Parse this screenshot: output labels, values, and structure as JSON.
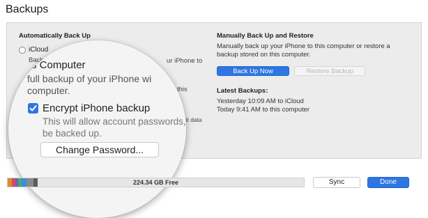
{
  "title": "Backups",
  "auto_backup": {
    "heading": "Automatically Back Up",
    "icloud_label": "iCloud",
    "icloud_desc_fragment": "Back",
    "icloud_desc_right": "ur iPhone to",
    "computer_desc_right": "this",
    "homekit_fragment": "meKit data to"
  },
  "magnifier": {
    "computer_label": "s Computer",
    "computer_desc_line1": "full backup of your iPhone wi",
    "computer_desc_line2": "computer.",
    "encrypt_label": "Encrypt iPhone backup",
    "encrypt_checked": true,
    "encrypt_desc_line1": "This will allow account passwords,",
    "encrypt_desc_line2": "be backed up.",
    "change_password_label": "Change Password..."
  },
  "manual": {
    "heading": "Manually Back Up and Restore",
    "desc_line1": "Manually back up your iPhone to this computer or restore a",
    "desc_line2": "backup stored on this computer.",
    "back_up_now_label": "Back Up Now",
    "restore_backup_label": "Restore Backup"
  },
  "latest": {
    "heading": "Latest Backups:",
    "line1": "Yesterday 10:09 AM to iCloud",
    "line2": "Today 9:41 AM to this computer"
  },
  "footer": {
    "free_space": "224.34 GB Free",
    "sync_label": "Sync",
    "done_label": "Done"
  },
  "colors": {
    "accent": "#2d76e3",
    "panel_bg": "#ececec"
  }
}
